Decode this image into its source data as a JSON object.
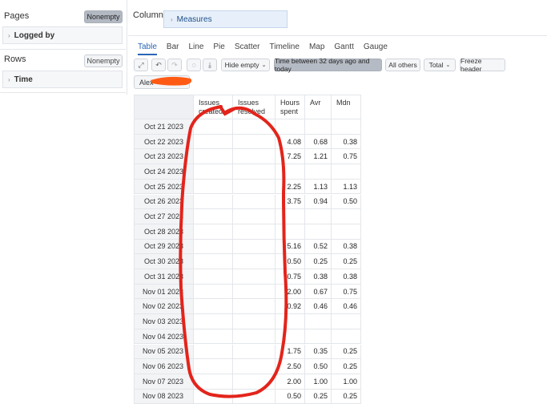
{
  "pages": {
    "title": "Pages",
    "nonempty_label": "Nonempty",
    "dimension": "Logged by"
  },
  "rows": {
    "title": "Rows",
    "nonempty_label": "Nonempty",
    "dimension": "Time"
  },
  "columns": {
    "title": "Columns",
    "dimension": "Measures"
  },
  "tabs": [
    "Table",
    "Bar",
    "Line",
    "Pie",
    "Scatter",
    "Timeline",
    "Map",
    "Gantt",
    "Gauge"
  ],
  "active_tab": "Table",
  "toolbar": {
    "hide_empty": "Hide empty",
    "time_filter": "Time between 32 days ago and today",
    "all_others": "All others",
    "total": "Total",
    "freeze_header": "Freeze header"
  },
  "page_filter_chip": "Alex",
  "table": {
    "headers": [
      "Issues created",
      "Issues resolved",
      "Hours spent",
      "Avr",
      "Mdn"
    ],
    "rows": [
      {
        "date": "Oct 21 2023",
        "ic": "",
        "ir": "",
        "hs": "",
        "avr": "",
        "mdn": ""
      },
      {
        "date": "Oct 22 2023",
        "ic": "",
        "ir": "",
        "hs": "4.08",
        "avr": "0.68",
        "mdn": "0.38"
      },
      {
        "date": "Oct 23 2023",
        "ic": "",
        "ir": "",
        "hs": "7.25",
        "avr": "1.21",
        "mdn": "0.75"
      },
      {
        "date": "Oct 24 2023",
        "ic": "",
        "ir": "",
        "hs": "",
        "avr": "",
        "mdn": ""
      },
      {
        "date": "Oct 25 2023",
        "ic": "",
        "ir": "",
        "hs": "2.25",
        "avr": "1.13",
        "mdn": "1.13"
      },
      {
        "date": "Oct 26 2023",
        "ic": "",
        "ir": "",
        "hs": "3.75",
        "avr": "0.94",
        "mdn": "0.50"
      },
      {
        "date": "Oct 27 2023",
        "ic": "",
        "ir": "",
        "hs": "",
        "avr": "",
        "mdn": ""
      },
      {
        "date": "Oct 28 2023",
        "ic": "",
        "ir": "",
        "hs": "",
        "avr": "",
        "mdn": ""
      },
      {
        "date": "Oct 29 2023",
        "ic": "",
        "ir": "",
        "hs": "5.16",
        "avr": "0.52",
        "mdn": "0.38"
      },
      {
        "date": "Oct 30 2023",
        "ic": "",
        "ir": "",
        "hs": "0.50",
        "avr": "0.25",
        "mdn": "0.25"
      },
      {
        "date": "Oct 31 2023",
        "ic": "",
        "ir": "",
        "hs": "0.75",
        "avr": "0.38",
        "mdn": "0.38"
      },
      {
        "date": "Nov 01 2023",
        "ic": "",
        "ir": "",
        "hs": "2.00",
        "avr": "0.67",
        "mdn": "0.75"
      },
      {
        "date": "Nov 02 2023",
        "ic": "",
        "ir": "",
        "hs": "0.92",
        "avr": "0.46",
        "mdn": "0.46"
      },
      {
        "date": "Nov 03 2023",
        "ic": "",
        "ir": "",
        "hs": "",
        "avr": "",
        "mdn": ""
      },
      {
        "date": "Nov 04 2023",
        "ic": "",
        "ir": "",
        "hs": "",
        "avr": "",
        "mdn": ""
      },
      {
        "date": "Nov 05 2023",
        "ic": "",
        "ir": "",
        "hs": "1.75",
        "avr": "0.35",
        "mdn": "0.25"
      },
      {
        "date": "Nov 06 2023",
        "ic": "",
        "ir": "",
        "hs": "2.50",
        "avr": "0.50",
        "mdn": "0.25"
      },
      {
        "date": "Nov 07 2023",
        "ic": "",
        "ir": "",
        "hs": "2.00",
        "avr": "1.00",
        "mdn": "1.00"
      },
      {
        "date": "Nov 08 2023",
        "ic": "",
        "ir": "",
        "hs": "0.50",
        "avr": "0.25",
        "mdn": "0.25"
      }
    ]
  },
  "colors": {
    "annotation_red": "#e3241b",
    "redact_orange": "#ff5a14",
    "accent_blue": "#2a66b5"
  }
}
